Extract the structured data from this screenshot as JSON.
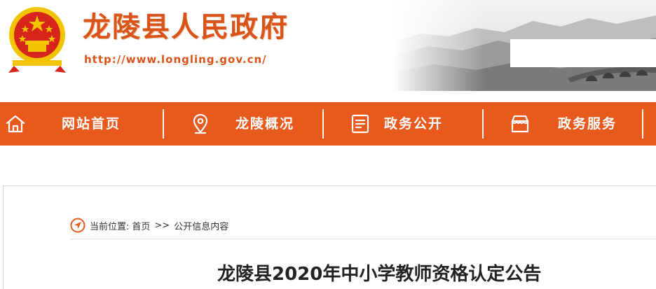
{
  "header": {
    "site_title": "龙陵县人民政府",
    "site_url": "http://www.longling.gov.cn/",
    "emblem_icon": "national-emblem-icon"
  },
  "nav": {
    "items": [
      {
        "label": "网站首页",
        "icon": "home-icon"
      },
      {
        "label": "龙陵概况",
        "icon": "location-pin-icon"
      },
      {
        "label": "政务公开",
        "icon": "document-list-icon"
      },
      {
        "label": "政务服务",
        "icon": "service-box-icon"
      }
    ]
  },
  "breadcrumb": {
    "prefix": "当前位置:",
    "home": "首页",
    "separator": ">>",
    "current": "公开信息内容"
  },
  "article": {
    "title": "龙陵县2020年中小学教师资格认定公告"
  },
  "colors": {
    "brand_orange": "#e8591e",
    "title_orange": "#d9541a",
    "emblem_red": "#d7251c",
    "emblem_gold": "#f2c400"
  }
}
